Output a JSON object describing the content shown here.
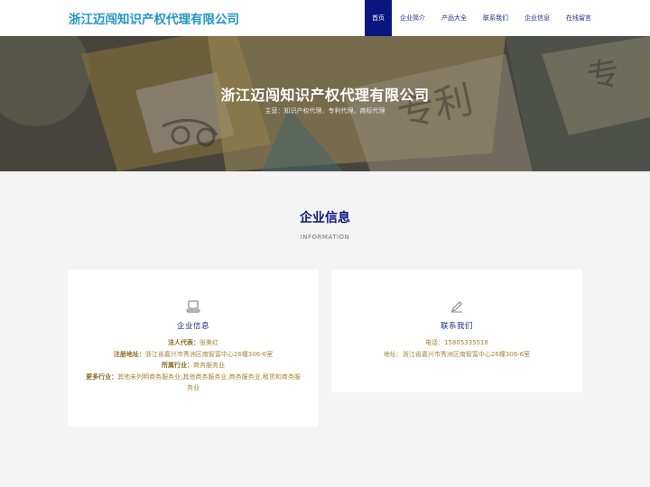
{
  "header": {
    "brand": "浙江迈闯知识产权代理有限公司",
    "nav": [
      {
        "label": "首页",
        "active": true
      },
      {
        "label": "企业简介",
        "active": false
      },
      {
        "label": "产品大全",
        "active": false
      },
      {
        "label": "联系我们",
        "active": false
      },
      {
        "label": "企业信息",
        "active": false
      },
      {
        "label": "在线留言",
        "active": false
      }
    ]
  },
  "banner": {
    "title": "浙江迈闯知识产权代理有限公司",
    "subtitle": "主营：知识产权代理、专利代理、商标代理",
    "art_text_1": "专利",
    "art_text_2": "专"
  },
  "section": {
    "title": "企业信息",
    "subtitle": "INFORMATION"
  },
  "cards": {
    "company": {
      "icon": "laptop-icon",
      "heading": "企业信息",
      "rows": [
        {
          "key": "法人代表：",
          "value": "张美红"
        },
        {
          "key": "注册地址：",
          "value": "浙江省嘉兴市秀洲区南智富中心26幢306-6室"
        },
        {
          "key": "所属行业：",
          "value": "商务服务业"
        },
        {
          "key": "更多行业：",
          "value": "其他未列明商务服务业,其他商务服务业,商务服务业,租赁和商务服务业"
        }
      ]
    },
    "contact": {
      "icon": "pencil-icon",
      "heading": "联系我们",
      "rows": [
        {
          "key": "电话：",
          "value": "15805335518"
        },
        {
          "key": "地址：",
          "value": "浙江省嘉兴市秀洲区南智富中心26幢306-6室"
        }
      ]
    }
  },
  "colors": {
    "brand": "#2196c9",
    "nav_active_bg": "#0a1580",
    "heading": "#0a1580",
    "detail_text": "#a3843a"
  }
}
